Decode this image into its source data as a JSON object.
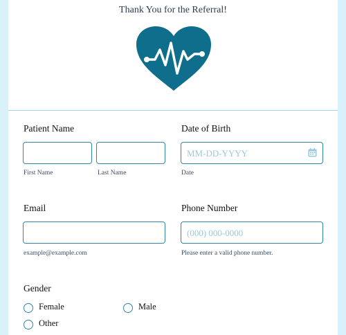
{
  "header": {
    "thanks_text": "Thank You for the Referral!",
    "logo_icon": "heartbeat-heart-icon",
    "accent_color": "#0e6e8b"
  },
  "patient_name": {
    "label": "Patient Name",
    "first_sublabel": "First Name",
    "last_sublabel": "Last Name"
  },
  "dob": {
    "label": "Date of Birth",
    "placeholder": "MM-DD-YYYY",
    "sublabel": "Date",
    "icon": "calendar-icon"
  },
  "email": {
    "label": "Email",
    "sublabel": "example@example.com"
  },
  "phone": {
    "label": "Phone Number",
    "placeholder": "(000) 000-0000",
    "sublabel": "Please enter a valid phone number."
  },
  "gender": {
    "label": "Gender",
    "options": [
      "Female",
      "Male",
      "Other"
    ]
  }
}
